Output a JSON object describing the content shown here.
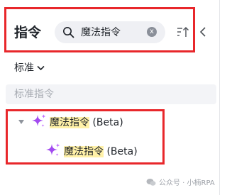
{
  "panel": {
    "title": "指令"
  },
  "search": {
    "query": "魔法指令",
    "clear_glyph": "x"
  },
  "toolbar": {
    "sort_icon": "sort-up-icon",
    "collapse_icon": "chevron-left-icon"
  },
  "filter": {
    "selected": "标准"
  },
  "section": {
    "label": "标准指令"
  },
  "tree": {
    "parent": {
      "highlight": "魔法指令",
      "suffix": " (Beta)"
    },
    "child": {
      "highlight": "魔法指令",
      "suffix": " (Beta)"
    }
  },
  "watermark": {
    "text": "公众号 · 小楠RPA"
  },
  "colors": {
    "annotation_red": "#e8272b",
    "sparkle_purple": "#a24bf0",
    "highlight_yellow": "#fff1a8"
  }
}
